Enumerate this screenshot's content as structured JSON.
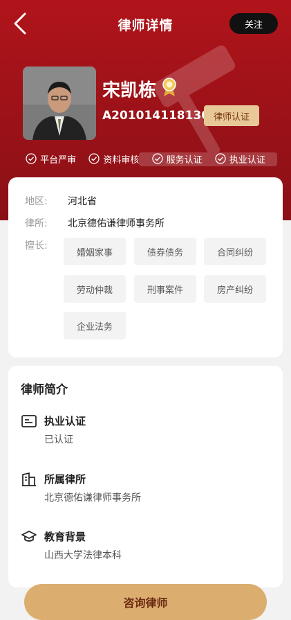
{
  "header": {
    "title": "律师详情",
    "follow_label": "关注"
  },
  "lawyer": {
    "name": "宋凯栋",
    "license_no": "A20101411813021",
    "cert_label": "律师认证"
  },
  "checks": [
    "平台严审",
    "资料审核",
    "服务认证",
    "执业认证"
  ],
  "info": {
    "region_label": "地区:",
    "region_value": "河北省",
    "firm_label": "律所:",
    "firm_value": "北京德佑谦律师事务所",
    "expertise_label": "擅长:",
    "tags": [
      "婚姻家事",
      "债券债务",
      "合同纠纷",
      "劳动仲裁",
      "刑事案件",
      "房产纠纷",
      "企业法务"
    ]
  },
  "intro": {
    "title": "律师简介",
    "items": [
      {
        "icon": "id-card-icon",
        "heading": "执业认证",
        "value": "已认证"
      },
      {
        "icon": "building-icon",
        "heading": "所属律所",
        "value": "北京德佑谦律师事务所"
      },
      {
        "icon": "graduation-cap-icon",
        "heading": "教育背景",
        "value": "山西大学法律本科"
      }
    ]
  },
  "footer": {
    "consult_label": "咨询律师"
  },
  "colors": {
    "hero_red": "#9a1218",
    "gold": "#dbae6f",
    "badge_gold": "#e8c897"
  }
}
